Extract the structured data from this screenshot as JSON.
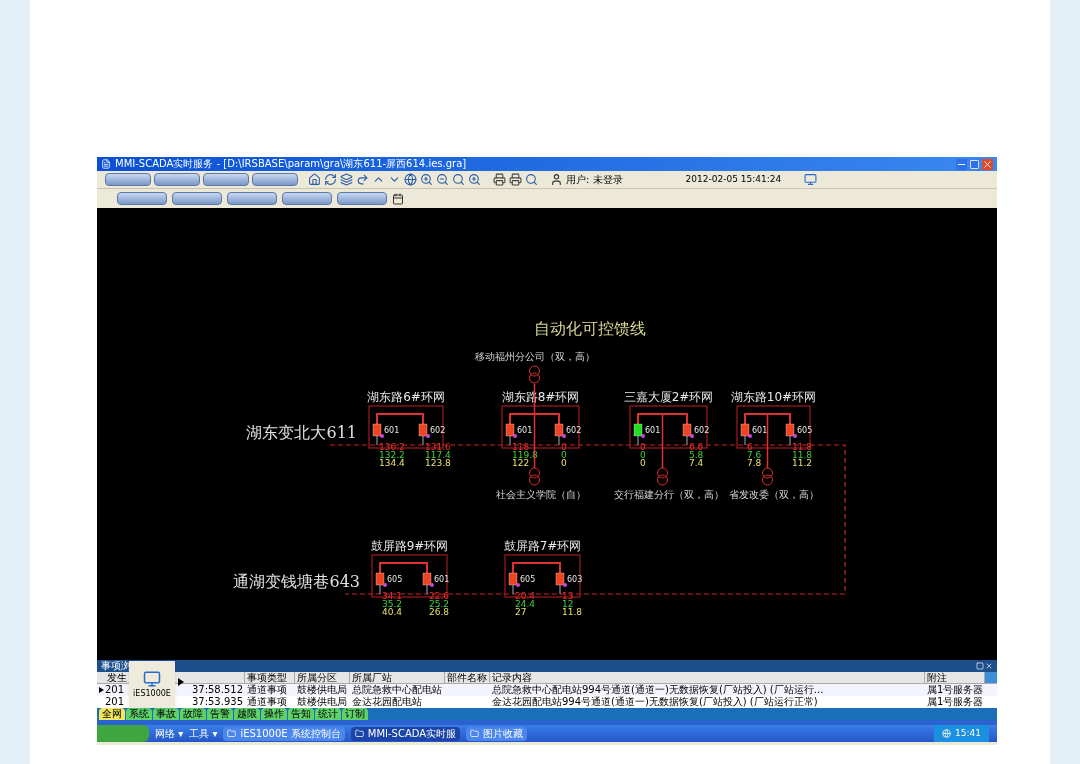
{
  "window": {
    "title": "MMI-SCADA实时服务 - [D:\\IRSBASE\\param\\gra\\湖东611-屏西614.ies.gra]"
  },
  "toolbar": {
    "user": "用户: 未登录",
    "datetime": "2012-02-05 15:41:24"
  },
  "diagram": {
    "title": "自动化可控馈线",
    "feeders": [
      {
        "name": "湖东变北大611",
        "units": [
          {
            "name": "湖东路6#环网",
            "switches": [
              {
                "number": "601",
                "closed": true,
                "readings": [
                  "136.2",
                  "132.2",
                  "134.4"
                ]
              },
              {
                "number": "602",
                "closed": true,
                "readings": [
                  "131.6",
                  "117.4",
                  "123.8"
                ]
              }
            ]
          },
          {
            "name": "湖东路8#环网",
            "switches": [
              {
                "number": "601",
                "closed": true,
                "readings": [
                  "118",
                  "119.8",
                  "122"
                ]
              },
              {
                "number": "602",
                "closed": true,
                "readings": [
                  "0",
                  "0",
                  "0"
                ]
              }
            ],
            "loads": [
              {
                "label": "移动福州分公司（双，高）",
                "kind": "above"
              },
              {
                "label": "社会主义学院（自）",
                "kind": "below"
              }
            ]
          },
          {
            "name": "三嘉大厦2#环网",
            "switches": [
              {
                "number": "601",
                "closed": false,
                "readings": [
                  "0",
                  "0",
                  "0"
                ]
              },
              {
                "number": "602",
                "closed": true,
                "readings": [
                  "6.6",
                  "5.8",
                  "7.4"
                ]
              }
            ],
            "loads": [
              {
                "label": "交行福建分行（双，高）",
                "kind": "below"
              }
            ]
          },
          {
            "name": "湖东路10#环网",
            "switches": [
              {
                "number": "601",
                "closed": true,
                "readings": [
                  "6",
                  "7.6",
                  "7.8"
                ]
              },
              {
                "number": "605",
                "closed": true,
                "readings": [
                  "11.8",
                  "11.8",
                  "11.2"
                ]
              }
            ],
            "loads": [
              {
                "label": "省发改委（双，高）",
                "kind": "below"
              }
            ]
          }
        ]
      },
      {
        "name": "通湖变钱塘巷643",
        "units": [
          {
            "name": "鼓屏路9#环网",
            "switches": [
              {
                "number": "605",
                "closed": true,
                "readings": [
                  "34.1",
                  "35.2",
                  "40.4"
                ]
              },
              {
                "number": "601",
                "closed": true,
                "readings": [
                  "22.6",
                  "25.2",
                  "26.8"
                ]
              }
            ]
          },
          {
            "name": "鼓屏路7#环网",
            "switches": [
              {
                "number": "605",
                "closed": true,
                "readings": [
                  "20.4",
                  "24.4",
                  "27"
                ]
              },
              {
                "number": "603",
                "closed": true,
                "readings": [
                  "13",
                  "12",
                  "11.8"
                ]
              }
            ]
          }
        ]
      }
    ]
  },
  "events": {
    "title": "事项浏",
    "columns": [
      "发生",
      "事项类型",
      "所属分区",
      "所属厂站",
      "部件名称",
      "记录内容",
      "附注"
    ],
    "rows": [
      {
        "selected": true,
        "cells": [
          [
            "201",
            "37:58.512"
          ],
          "通道事项",
          "鼓楼供电局",
          "总院急救中心配电站",
          "",
          "总院急救中心配电站994号通道(通道一)无数据恢复(厂站投入) (厂站运行...",
          "属1号服务器"
        ]
      },
      {
        "selected": false,
        "cells": [
          [
            "201",
            "37:53.935"
          ],
          "通道事项",
          "鼓楼供电局",
          "金达花园配电站",
          "",
          "金达花园配电站994号通道(通道一)无数据恢复(厂站投入) (厂站运行正常)",
          "属1号服务器"
        ]
      }
    ],
    "popup": {
      "label": "iES1000E"
    },
    "tabs": [
      {
        "label": "全网",
        "selected": true
      },
      {
        "label": "系统",
        "selected": false
      },
      {
        "label": "事故",
        "selected": false
      },
      {
        "label": "故障",
        "selected": false
      },
      {
        "label": "告警",
        "selected": false
      },
      {
        "label": "越限",
        "selected": false
      },
      {
        "label": "操作",
        "selected": false
      },
      {
        "label": "告知",
        "selected": false
      },
      {
        "label": "统计",
        "selected": false
      },
      {
        "label": "订制",
        "selected": false
      }
    ]
  },
  "taskbar": {
    "menus": [
      "网络 ▾",
      "工具 ▾"
    ],
    "tasks": [
      {
        "label": "iES1000E 系统控制台",
        "selected": false
      },
      {
        "label": "MMI-SCADA实时服",
        "selected": true
      },
      {
        "label": "图片收藏",
        "selected": false
      }
    ],
    "clock": "15:41"
  }
}
